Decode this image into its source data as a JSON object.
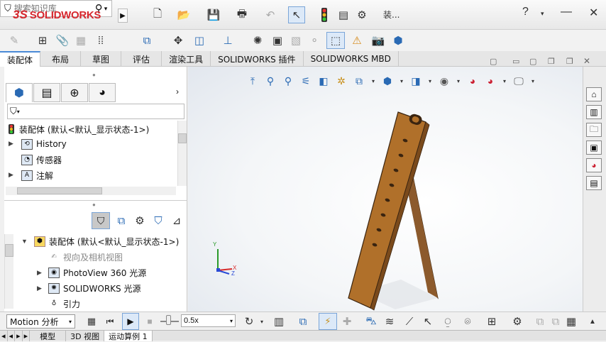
{
  "app": {
    "logo_ds": "3S",
    "logo_name": "SOLIDWORKS",
    "active_doc_short": "装..."
  },
  "search": {
    "placeholder": "搜索知识库"
  },
  "window": {
    "help": "?",
    "minimize": "—",
    "close": "✕"
  },
  "command_tabs": [
    "装配体",
    "布局",
    "草图",
    "评估",
    "渲染工具",
    "SOLIDWORKS 插件",
    "SOLIDWORKS MBD"
  ],
  "feature_tree": {
    "top_item": "装配体 (默认<默认_显示状态-1>)",
    "items": [
      {
        "label": "History",
        "icon": "history-icon"
      },
      {
        "label": "传感器",
        "icon": "sensor-icon"
      },
      {
        "label": "注解",
        "icon": "annotation-icon"
      }
    ]
  },
  "motion_tree": {
    "top_item": "装配体 (默认<默认_显示状态-1>)",
    "items": [
      {
        "label": "视向及相机视图",
        "icon": "camera-view-icon"
      },
      {
        "label": "PhotoView 360 光源",
        "icon": "photoview-light-icon"
      },
      {
        "label": "SOLIDWORKS 光源",
        "icon": "solidworks-light-icon"
      },
      {
        "label": "引力",
        "icon": "gravity-icon"
      }
    ]
  },
  "motion_bar": {
    "study_type": "Motion 分析",
    "speed": "0.5x"
  },
  "bottom_tabs": [
    "模型",
    "3D 视图",
    "运动算例 1"
  ],
  "triad": {
    "x": "X",
    "y": "Y",
    "z": "Z"
  },
  "colors": {
    "accent": "#4a8ad6",
    "brand": "#d6262d",
    "wood": "#b0702a"
  }
}
